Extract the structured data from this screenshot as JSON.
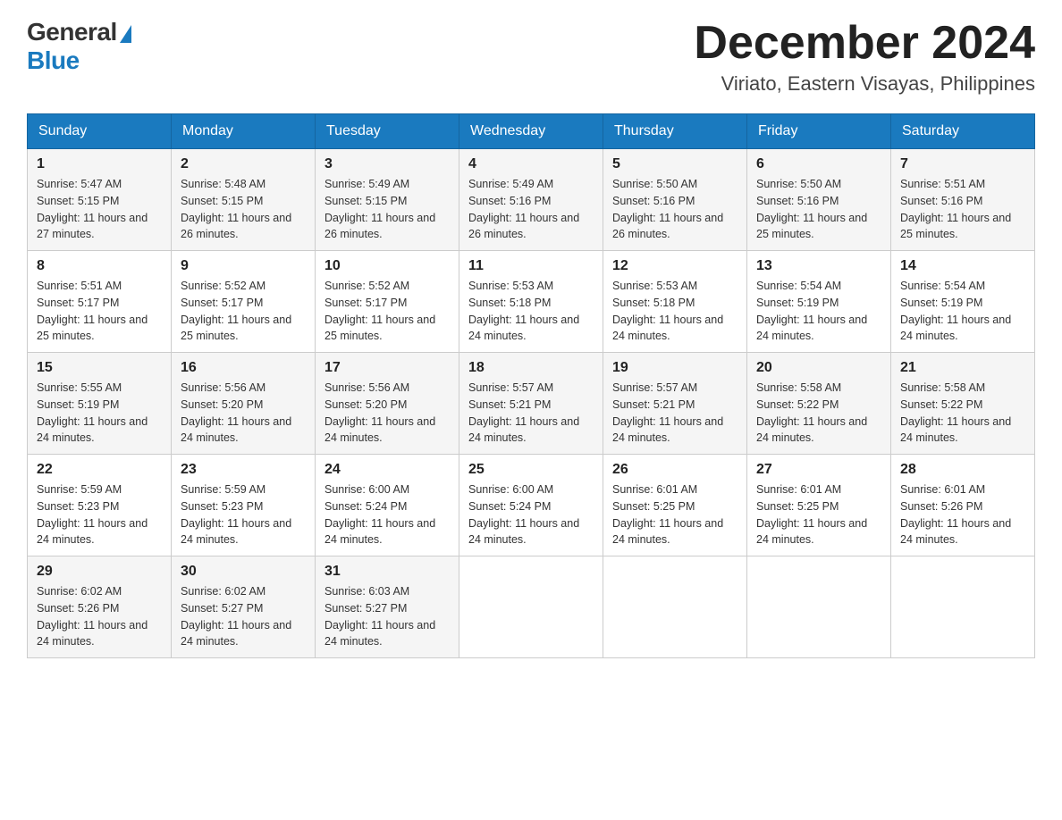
{
  "header": {
    "logo": {
      "text1": "General",
      "text2": "Blue"
    },
    "title": "December 2024",
    "location": "Viriato, Eastern Visayas, Philippines"
  },
  "days_of_week": [
    "Sunday",
    "Monday",
    "Tuesday",
    "Wednesday",
    "Thursday",
    "Friday",
    "Saturday"
  ],
  "weeks": [
    [
      {
        "date": "1",
        "sunrise": "5:47 AM",
        "sunset": "5:15 PM",
        "daylight": "11 hours and 27 minutes."
      },
      {
        "date": "2",
        "sunrise": "5:48 AM",
        "sunset": "5:15 PM",
        "daylight": "11 hours and 26 minutes."
      },
      {
        "date": "3",
        "sunrise": "5:49 AM",
        "sunset": "5:15 PM",
        "daylight": "11 hours and 26 minutes."
      },
      {
        "date": "4",
        "sunrise": "5:49 AM",
        "sunset": "5:16 PM",
        "daylight": "11 hours and 26 minutes."
      },
      {
        "date": "5",
        "sunrise": "5:50 AM",
        "sunset": "5:16 PM",
        "daylight": "11 hours and 26 minutes."
      },
      {
        "date": "6",
        "sunrise": "5:50 AM",
        "sunset": "5:16 PM",
        "daylight": "11 hours and 25 minutes."
      },
      {
        "date": "7",
        "sunrise": "5:51 AM",
        "sunset": "5:16 PM",
        "daylight": "11 hours and 25 minutes."
      }
    ],
    [
      {
        "date": "8",
        "sunrise": "5:51 AM",
        "sunset": "5:17 PM",
        "daylight": "11 hours and 25 minutes."
      },
      {
        "date": "9",
        "sunrise": "5:52 AM",
        "sunset": "5:17 PM",
        "daylight": "11 hours and 25 minutes."
      },
      {
        "date": "10",
        "sunrise": "5:52 AM",
        "sunset": "5:17 PM",
        "daylight": "11 hours and 25 minutes."
      },
      {
        "date": "11",
        "sunrise": "5:53 AM",
        "sunset": "5:18 PM",
        "daylight": "11 hours and 24 minutes."
      },
      {
        "date": "12",
        "sunrise": "5:53 AM",
        "sunset": "5:18 PM",
        "daylight": "11 hours and 24 minutes."
      },
      {
        "date": "13",
        "sunrise": "5:54 AM",
        "sunset": "5:19 PM",
        "daylight": "11 hours and 24 minutes."
      },
      {
        "date": "14",
        "sunrise": "5:54 AM",
        "sunset": "5:19 PM",
        "daylight": "11 hours and 24 minutes."
      }
    ],
    [
      {
        "date": "15",
        "sunrise": "5:55 AM",
        "sunset": "5:19 PM",
        "daylight": "11 hours and 24 minutes."
      },
      {
        "date": "16",
        "sunrise": "5:56 AM",
        "sunset": "5:20 PM",
        "daylight": "11 hours and 24 minutes."
      },
      {
        "date": "17",
        "sunrise": "5:56 AM",
        "sunset": "5:20 PM",
        "daylight": "11 hours and 24 minutes."
      },
      {
        "date": "18",
        "sunrise": "5:57 AM",
        "sunset": "5:21 PM",
        "daylight": "11 hours and 24 minutes."
      },
      {
        "date": "19",
        "sunrise": "5:57 AM",
        "sunset": "5:21 PM",
        "daylight": "11 hours and 24 minutes."
      },
      {
        "date": "20",
        "sunrise": "5:58 AM",
        "sunset": "5:22 PM",
        "daylight": "11 hours and 24 minutes."
      },
      {
        "date": "21",
        "sunrise": "5:58 AM",
        "sunset": "5:22 PM",
        "daylight": "11 hours and 24 minutes."
      }
    ],
    [
      {
        "date": "22",
        "sunrise": "5:59 AM",
        "sunset": "5:23 PM",
        "daylight": "11 hours and 24 minutes."
      },
      {
        "date": "23",
        "sunrise": "5:59 AM",
        "sunset": "5:23 PM",
        "daylight": "11 hours and 24 minutes."
      },
      {
        "date": "24",
        "sunrise": "6:00 AM",
        "sunset": "5:24 PM",
        "daylight": "11 hours and 24 minutes."
      },
      {
        "date": "25",
        "sunrise": "6:00 AM",
        "sunset": "5:24 PM",
        "daylight": "11 hours and 24 minutes."
      },
      {
        "date": "26",
        "sunrise": "6:01 AM",
        "sunset": "5:25 PM",
        "daylight": "11 hours and 24 minutes."
      },
      {
        "date": "27",
        "sunrise": "6:01 AM",
        "sunset": "5:25 PM",
        "daylight": "11 hours and 24 minutes."
      },
      {
        "date": "28",
        "sunrise": "6:01 AM",
        "sunset": "5:26 PM",
        "daylight": "11 hours and 24 minutes."
      }
    ],
    [
      {
        "date": "29",
        "sunrise": "6:02 AM",
        "sunset": "5:26 PM",
        "daylight": "11 hours and 24 minutes."
      },
      {
        "date": "30",
        "sunrise": "6:02 AM",
        "sunset": "5:27 PM",
        "daylight": "11 hours and 24 minutes."
      },
      {
        "date": "31",
        "sunrise": "6:03 AM",
        "sunset": "5:27 PM",
        "daylight": "11 hours and 24 minutes."
      },
      null,
      null,
      null,
      null
    ]
  ]
}
